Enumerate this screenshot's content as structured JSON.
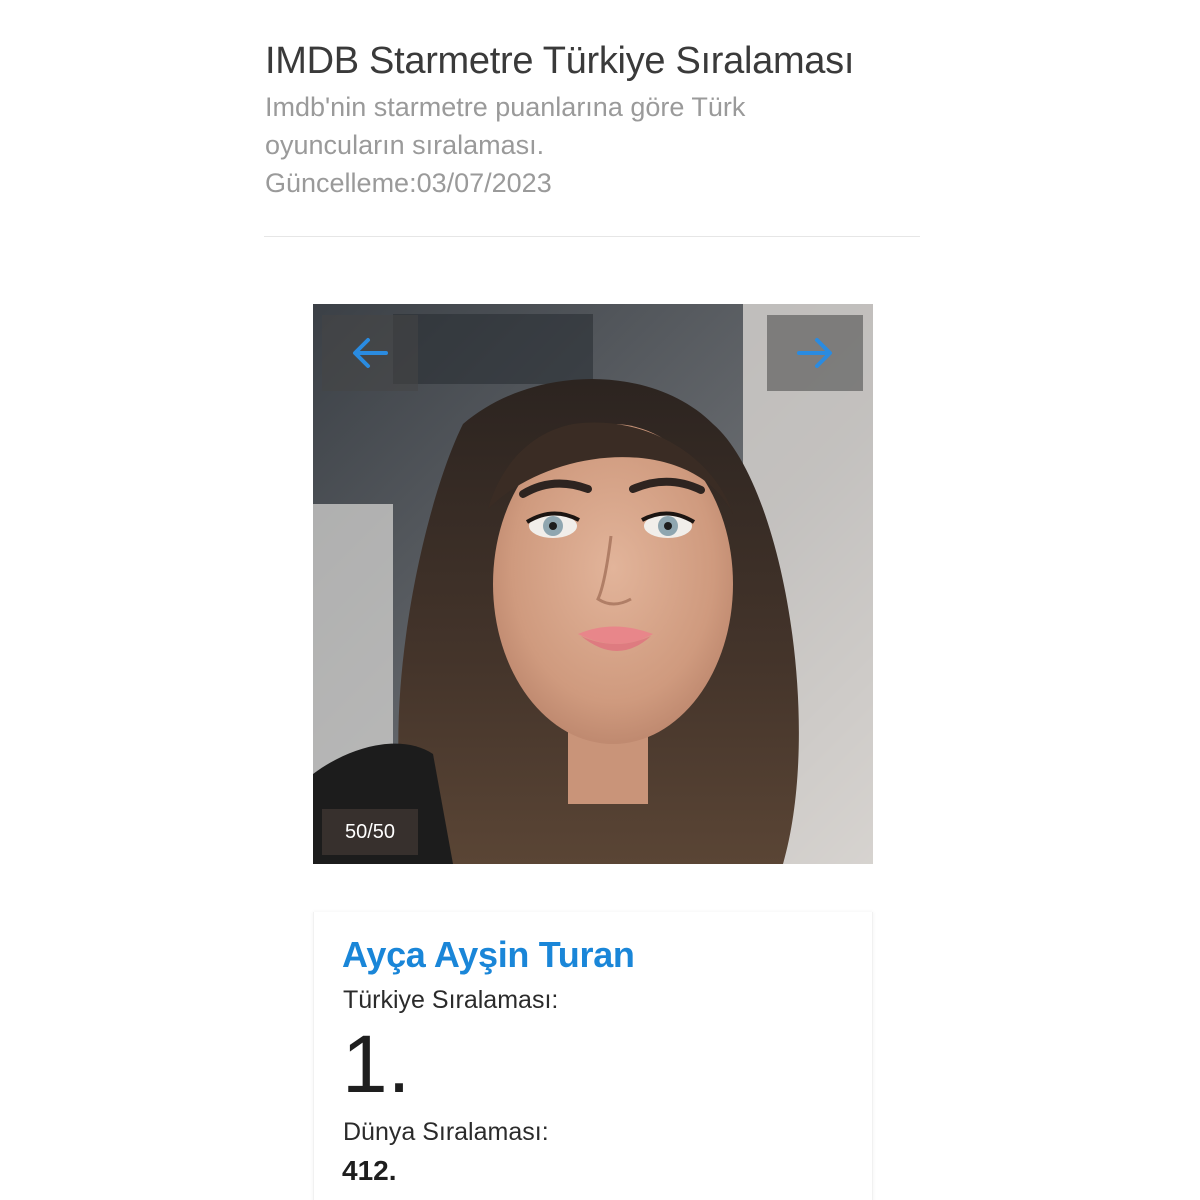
{
  "header": {
    "title": "IMDB Starmetre Türkiye Sıralaması",
    "description": "Imdb'nin starmetre puanlarına göre Türk oyuncuların sıralaması.",
    "updated": "Güncelleme:03/07/2023"
  },
  "slider": {
    "counter": "50/50",
    "prev_icon": "arrow-left-icon",
    "next_icon": "arrow-right-icon",
    "accent_color": "#1a86d8"
  },
  "card": {
    "name": "Ayça Ayşin Turan",
    "turkey_rank_label": "Türkiye Sıralaması:",
    "turkey_rank": "1.",
    "world_rank_label": "Dünya Sıralaması:",
    "world_rank": "412."
  }
}
